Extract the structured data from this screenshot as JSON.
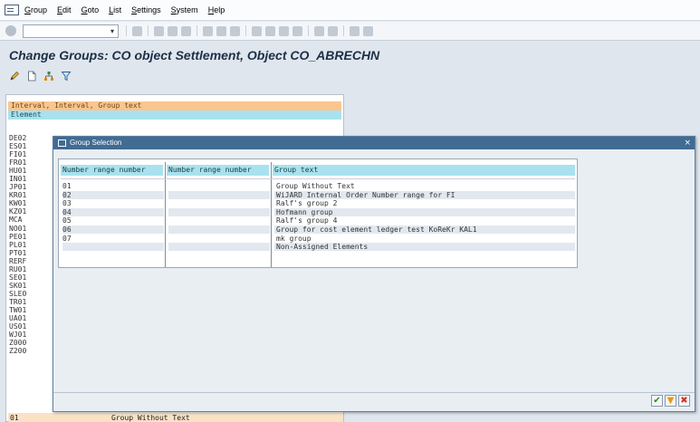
{
  "menubar": {
    "items": [
      "Group",
      "Edit",
      "Goto",
      "List",
      "Settings",
      "System",
      "Help"
    ],
    "underlined_first_letter": true
  },
  "stdbar": {
    "command_field": "",
    "dropdown_glyph": "▾"
  },
  "title": {
    "text": "Change Groups: CO object Settlement, Object CO_ABRECHN"
  },
  "app_toolbar": {
    "icons": [
      "pencil-icon",
      "new-document-icon",
      "hierarchy-icon",
      "filter-icon"
    ]
  },
  "background_list": {
    "header_line1": "Interval, Interval, Group text",
    "header_line2": "Element",
    "codes": [
      "DE02",
      "ES01",
      "FI01",
      "FR01",
      "HU01",
      "IN01",
      "JP01",
      "KR01",
      "KW01",
      "KZ01",
      "MCA",
      "NO01",
      "PE01",
      "PL01",
      "PT01",
      "RERF",
      "RU01",
      "SE01",
      "SK01",
      "SLEO",
      "TR01",
      "TW01",
      "UA01",
      "US01",
      "WJ01",
      "Z000",
      "Z200"
    ],
    "bottom_row": {
      "code": "01",
      "text": "Group Without Text"
    }
  },
  "dialog": {
    "title": "Group Selection",
    "close_glyph": "×",
    "columns": [
      "Number range number",
      "Number range number",
      "Group text"
    ],
    "rows": [
      {
        "from": "01",
        "to": "",
        "text": "Group Without Text"
      },
      {
        "from": "02",
        "to": "",
        "text": "WiJARD Internal Order Number range for FI"
      },
      {
        "from": "03",
        "to": "",
        "text": "Ralf's group 2"
      },
      {
        "from": "04",
        "to": "",
        "text": "Hofmann group"
      },
      {
        "from": "05",
        "to": "",
        "text": "Ralf's group 4"
      },
      {
        "from": "06",
        "to": "",
        "text": "Group for cost element ledger test KoReKr KAL1"
      },
      {
        "from": "07",
        "to": "",
        "text": "mk group"
      },
      {
        "from": "",
        "to": "",
        "text": "Non-Assigned Elements"
      }
    ],
    "buttons": {
      "ok": "✔",
      "filter": "▼",
      "cancel": "✖"
    }
  },
  "colors": {
    "title_text": "#1d2f45",
    "dialog_titlebar": "#416b93",
    "header_orange": "#fcc58e",
    "header_cyan": "#a8e2ee",
    "row_alt": "#e2e8ef"
  }
}
